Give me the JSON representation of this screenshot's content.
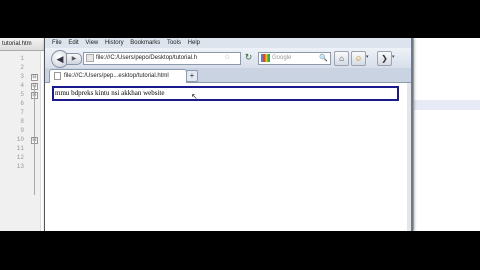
{
  "editor": {
    "tab_title": "tutorial.htm",
    "line_numbers": [
      "1",
      "2",
      "3",
      "4",
      "5",
      "6",
      "7",
      "8",
      "9",
      "10",
      "11",
      "12",
      "13"
    ],
    "fold_markers": [
      "⊟",
      "⊟",
      "⊟",
      "⊟"
    ]
  },
  "browser": {
    "menu": [
      "File",
      "Edit",
      "View",
      "History",
      "Bookmarks",
      "Tools",
      "Help"
    ],
    "nav": {
      "back": "◀",
      "forward": "▶",
      "url": "file:///C:/Users/pepo/Desktop/tutorial.h",
      "star": "☆",
      "reload": "↻",
      "search_placeholder": "Google",
      "search_go": "🔍",
      "home": "⌂",
      "addon": "☺",
      "more": "❯",
      "dropdown": "▾"
    },
    "tab": {
      "title": "file:///C:/Users/pep...esktop/tutorial.html",
      "new_tab": "+"
    },
    "page": {
      "input_value": "mmu bdpreks kintu nsi akkhan website",
      "cursor": "↖"
    }
  }
}
